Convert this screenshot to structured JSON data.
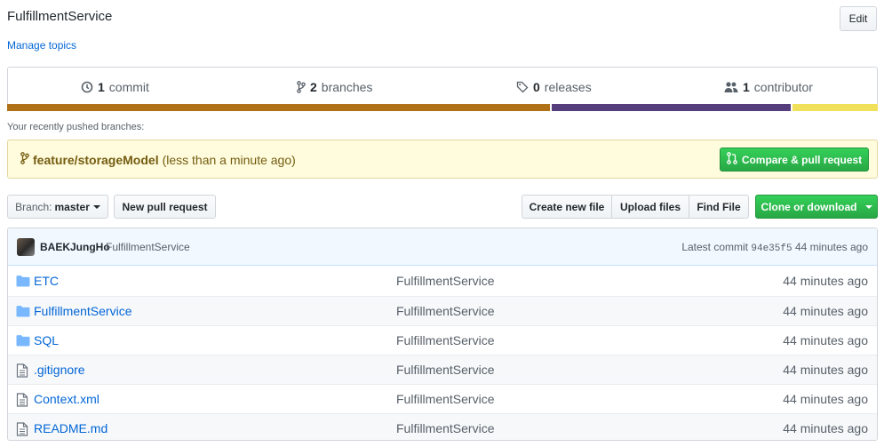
{
  "repo": {
    "description": "FulfillmentService",
    "manage_topics": "Manage topics",
    "edit_label": "Edit"
  },
  "summary": {
    "commits": {
      "count": "1",
      "label": "commit"
    },
    "branches": {
      "count": "2",
      "label": "branches"
    },
    "releases": {
      "count": "0",
      "label": "releases"
    },
    "contributors": {
      "count": "1",
      "label": "contributor"
    }
  },
  "languages": [
    {
      "color": "#b07219",
      "percent": 62.5
    },
    {
      "color": "#563d7c",
      "percent": 27.7
    },
    {
      "color": "#f1e05a",
      "percent": 9.8
    }
  ],
  "recent": {
    "label": "Your recently pushed branches:",
    "branch": "feature/storageModel",
    "time": "(less than a minute ago)",
    "compare_label": "Compare & pull request"
  },
  "toolbar": {
    "branch_prefix": "Branch:",
    "branch_name": "master",
    "new_pr": "New pull request",
    "create_file": "Create new file",
    "upload_files": "Upload files",
    "find_file": "Find File",
    "clone": "Clone or download"
  },
  "commit": {
    "author": "BAEKJungHo",
    "message": "FulfillmentService",
    "latest_label": "Latest commit",
    "sha": "94e35f5",
    "age": "44 minutes ago"
  },
  "files": [
    {
      "type": "folder",
      "icon": "folder-icon",
      "name": "ETC",
      "message": "FulfillmentService",
      "age": "44 minutes ago"
    },
    {
      "type": "folder",
      "icon": "folder-icon",
      "name": "FulfillmentService",
      "message": "FulfillmentService",
      "age": "44 minutes ago"
    },
    {
      "type": "folder",
      "icon": "folder-icon",
      "name": "SQL",
      "message": "FulfillmentService",
      "age": "44 minutes ago"
    },
    {
      "type": "file",
      "icon": "file-icon",
      "name": ".gitignore",
      "message": "FulfillmentService",
      "age": "44 minutes ago"
    },
    {
      "type": "file",
      "icon": "file-icon",
      "name": "Context.xml",
      "message": "FulfillmentService",
      "age": "44 minutes ago"
    },
    {
      "type": "file",
      "icon": "file-icon",
      "name": "README.md",
      "message": "FulfillmentService",
      "age": "44 minutes ago"
    }
  ]
}
